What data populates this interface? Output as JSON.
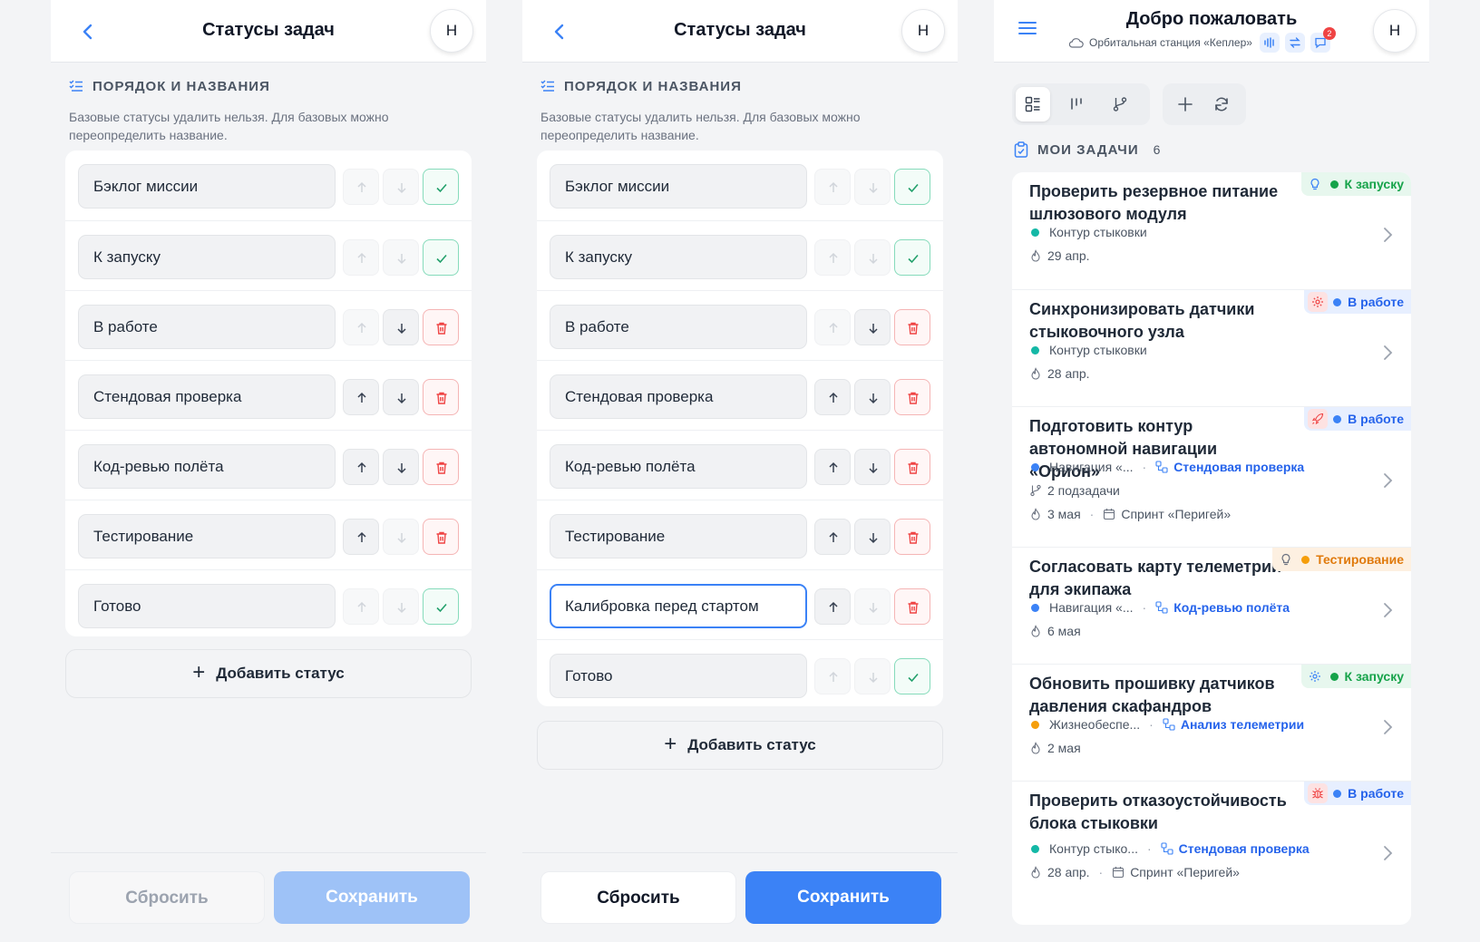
{
  "status_screen": {
    "title": "Статусы задач",
    "avatar": "Н",
    "section_title": "ПОРЯДОК И НАЗВАНИЯ",
    "section_desc": "Базовые статусы удалить нельзя. Для базовых можно переопределить название.",
    "add_label": "Добавить статус",
    "reset_label": "Сбросить",
    "save_label": "Сохранить"
  },
  "panel1_statuses": [
    "Бэклог миссии",
    "К запуску",
    "В работе",
    "Стендовая проверка",
    "Код-ревью полёта",
    "Тестирование",
    "Готово"
  ],
  "panel2_statuses": [
    "Бэклог миссии",
    "К запуску",
    "В работе",
    "Стендовая проверка",
    "Код-ревью полёта",
    "Тестирование",
    "Калибровка перед стартом",
    "Готово"
  ],
  "dashboard": {
    "title": "Добро пожаловать",
    "station": "Орбитальная станция «Кеплер»",
    "notifications": "2",
    "avatar": "Н",
    "tasks_label": "МОИ ЗАДАЧИ",
    "tasks_count": "6",
    "tasks": [
      {
        "title": "Проверить резервное питание шлюзового модуля",
        "status": "К запуску",
        "icon": "bulb-icon",
        "project": "Контур стыковки",
        "date": "29 апр."
      },
      {
        "title": "Синхронизировать датчики стыковочного узла",
        "status": "В работе",
        "icon": "gear-icon",
        "project": "Контур стыковки",
        "date": "28 апр."
      },
      {
        "title": "Подготовить контур автономной навигации «Орион»",
        "status": "В работе",
        "icon": "rocket-icon",
        "project": "Навигация «...",
        "stage": "Стендовая проверка",
        "subtasks": "2 подзадачи",
        "date": "3 мая",
        "sprint": "Спринт «Перигей»"
      },
      {
        "title": "Согласовать карту телеметрии для экипажа",
        "status": "Тестирование",
        "icon": "bulb-icon",
        "project": "Навигация «...",
        "stage": "Код-ревью полёта",
        "date": "6 мая"
      },
      {
        "title": "Обновить прошивку датчиков давления скафандров",
        "status": "К запуску",
        "icon": "gear-icon",
        "project": "Жизнеобеспе...",
        "stage": "Анализ телеметрии",
        "date": "2 мая"
      },
      {
        "title": "Проверить отказоустойчивость блока стыковки",
        "status": "В работе",
        "icon": "bug-icon",
        "project": "Контур стыко...",
        "stage": "Стендовая проверка",
        "date": "28 апр.",
        "sprint": "Спринт «Перигей»"
      }
    ]
  },
  "colors": {
    "accent": "#3b82f6",
    "success": "#16a34a",
    "danger": "#ef4444",
    "warning": "#f59e0b"
  }
}
